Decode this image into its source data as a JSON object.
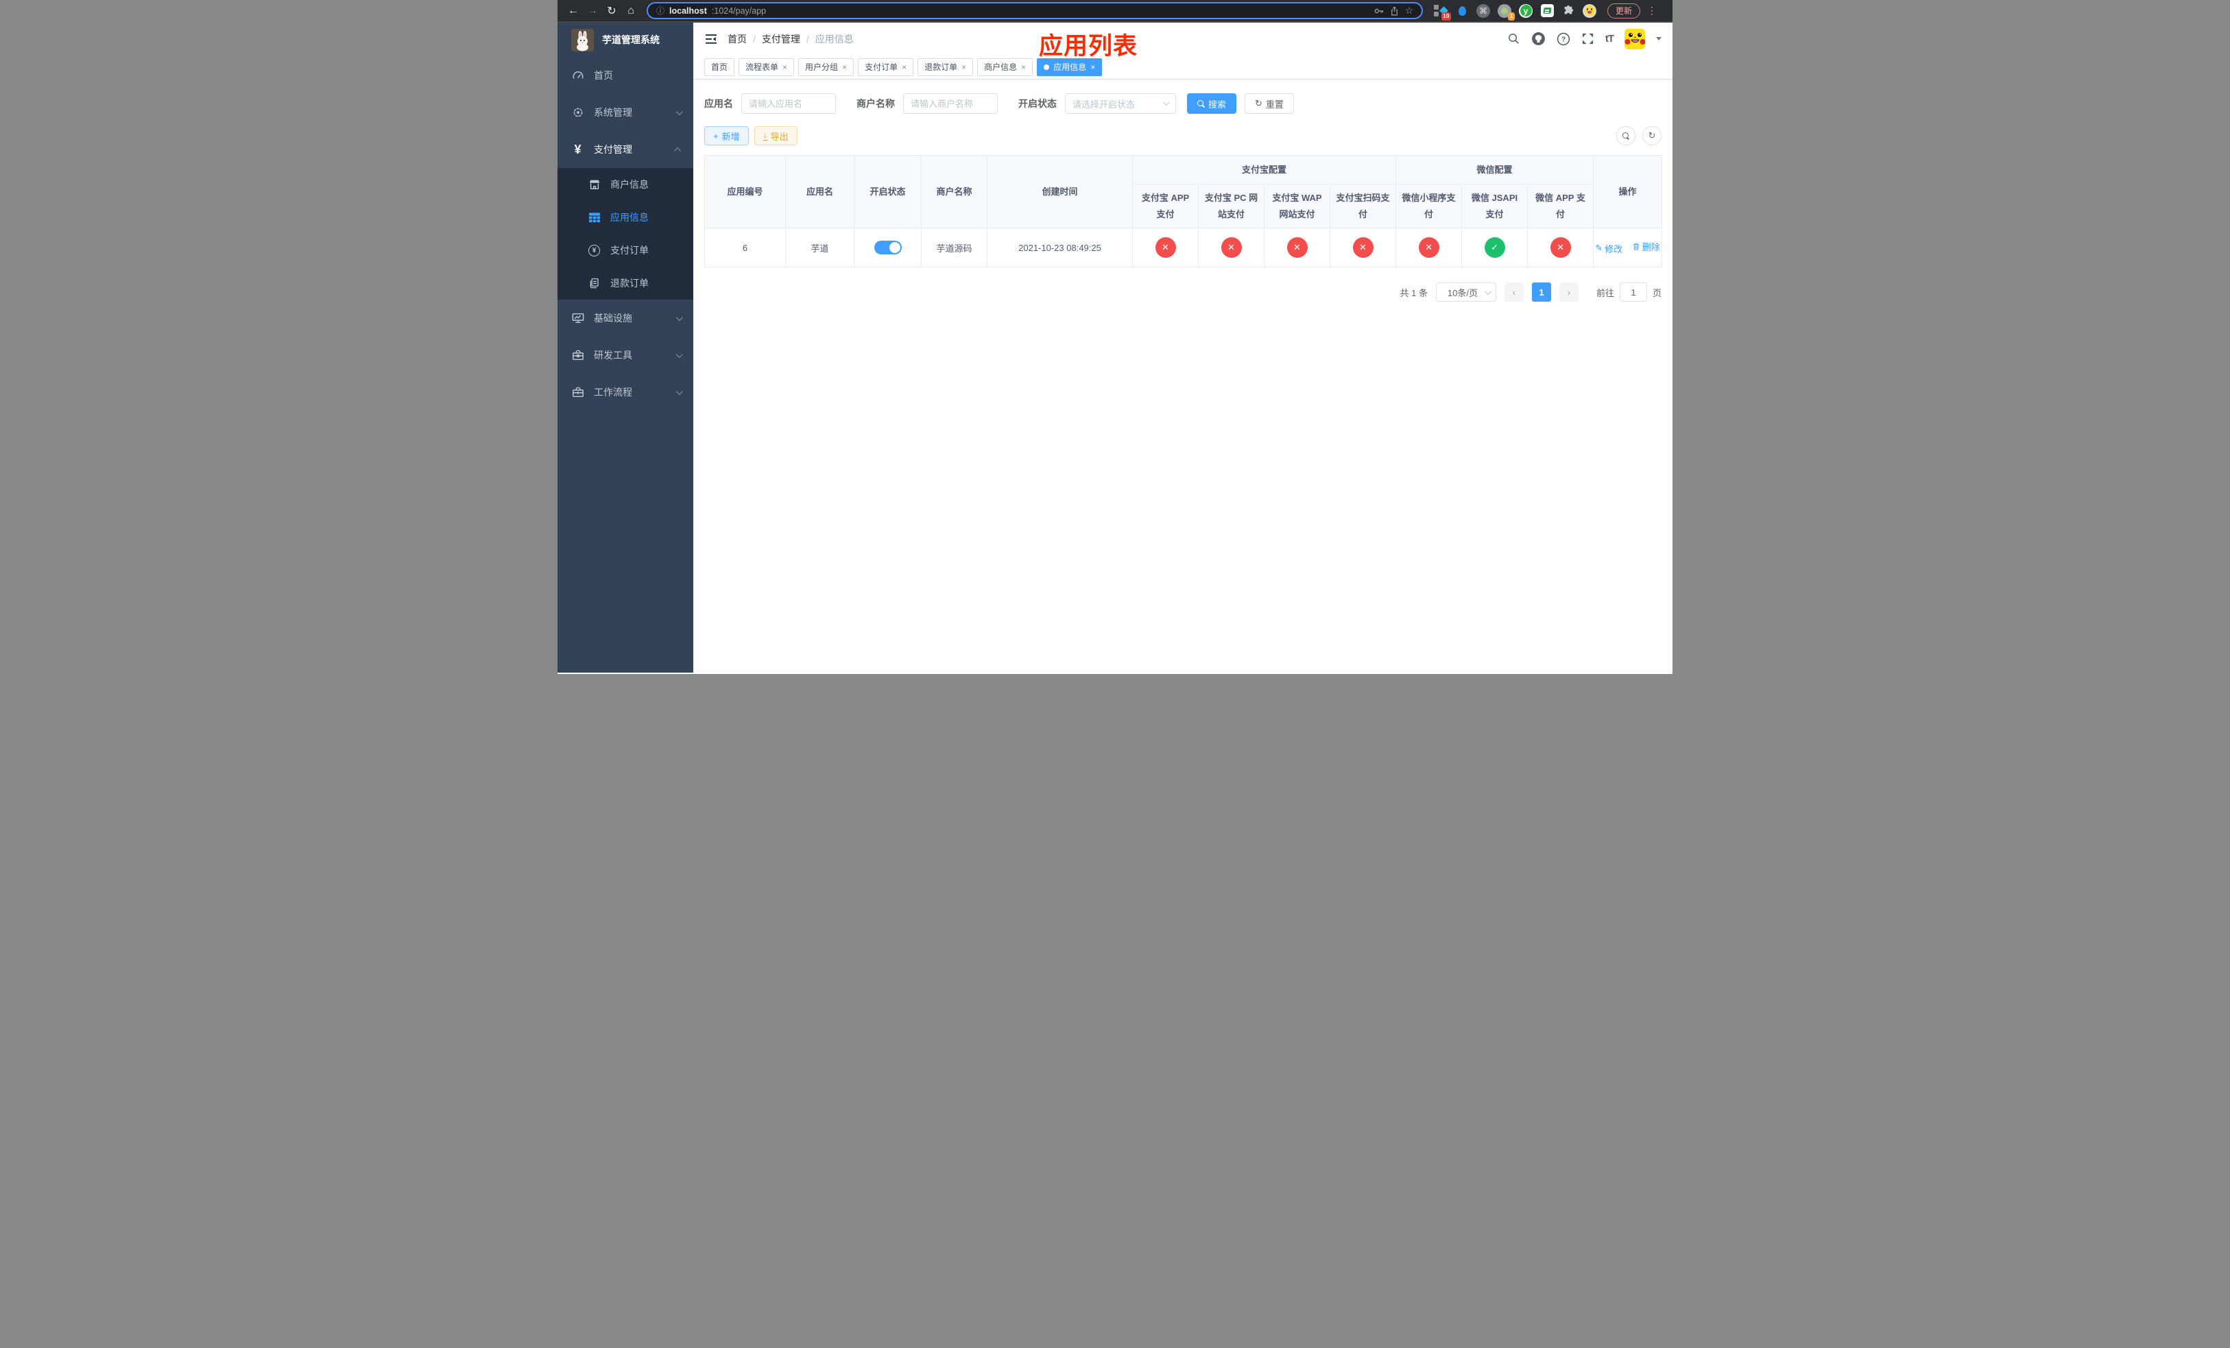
{
  "colors": {
    "accent": "#409eff",
    "danger_circle": "#f44d4d",
    "success_circle": "#1cc06d",
    "warning": "#e6a23c",
    "annotation_red": "#ff2b00",
    "sidebar_bg": "#344258",
    "submenu_bg": "#212c3c"
  },
  "icons": {
    "back": "←",
    "forward": "→",
    "reload": "↻",
    "home": "⌂",
    "info": "ⓘ",
    "star": "☆",
    "cmd": "⌘",
    "kebab": "⋮",
    "close": "×",
    "check": "✓",
    "cross": "✕",
    "yen": "¥",
    "plus": "+",
    "download": "↓",
    "refresh": "↻",
    "edit": "✎",
    "help": "?",
    "fontsize": "tT",
    "prev": "‹",
    "next": "›",
    "slash": "/",
    "ext_y": "y"
  },
  "browser": {
    "url_host": "localhost",
    "url_path": ":1024/pay/app",
    "ext_badge_blocks": "10",
    "ext_badge_cam": "1",
    "update_button": "更新"
  },
  "sidebar": {
    "title": "芋道管理系统",
    "items": [
      {
        "label": "首页",
        "icon": "dashboard-icon"
      },
      {
        "label": "系统管理",
        "icon": "gear-icon"
      },
      {
        "label": "支付管理",
        "icon": "yen-icon"
      },
      {
        "label": "基础设施",
        "icon": "monitor-icon"
      },
      {
        "label": "研发工具",
        "icon": "toolbox-icon"
      },
      {
        "label": "工作流程",
        "icon": "briefcase-icon"
      }
    ],
    "submenu": [
      {
        "label": "商户信息",
        "icon": "shop-icon"
      },
      {
        "label": "应用信息",
        "icon": "grid-icon"
      },
      {
        "label": "支付订单",
        "icon": "pay-order-icon"
      },
      {
        "label": "退款订单",
        "icon": "refund-icon"
      }
    ]
  },
  "header": {
    "breadcrumb": [
      "首页",
      "支付管理",
      "应用信息"
    ],
    "annotation": "应用列表"
  },
  "tabs": [
    {
      "label": "首页"
    },
    {
      "label": "流程表单"
    },
    {
      "label": "用户分组"
    },
    {
      "label": "支付订单"
    },
    {
      "label": "退款订单"
    },
    {
      "label": "商户信息"
    },
    {
      "label": "应用信息"
    }
  ],
  "filters": {
    "app_name_label": "应用名",
    "app_name_placeholder": "请输入应用名",
    "merchant_label": "商户名称",
    "merchant_placeholder": "请输入商户名称",
    "status_label": "开启状态",
    "status_placeholder": "请选择开启状态",
    "search_button": "搜索",
    "reset_button": "重置"
  },
  "toolbar": {
    "add_button": "新增",
    "export_button": "导出"
  },
  "table": {
    "group_headers": {
      "alipay": "支付宝配置",
      "wechat": "微信配置"
    },
    "columns": [
      "应用编号",
      "应用名",
      "开启状态",
      "商户名称",
      "创建时间",
      "支付宝 APP 支付",
      "支付宝 PC 网站支付",
      "支付宝 WAP 网站支付",
      "支付宝扫码支付",
      "微信小程序支付",
      "微信 JSAPI 支付",
      "微信 APP 支付",
      "操作"
    ],
    "row": {
      "id": "6",
      "app_name": "芋道",
      "enabled": true,
      "merchant_name": "芋道源码",
      "created_at": "2021-10-23 08:49:25",
      "pay_statuses": [
        false,
        false,
        false,
        false,
        false,
        true,
        false
      ],
      "edit_action": "修改",
      "delete_action": "删除"
    }
  },
  "pagination": {
    "total_text": "共 1 条",
    "page_size": "10条/页",
    "current_page": "1",
    "goto_label": "前往",
    "goto_value": "1",
    "page_unit": "页"
  }
}
